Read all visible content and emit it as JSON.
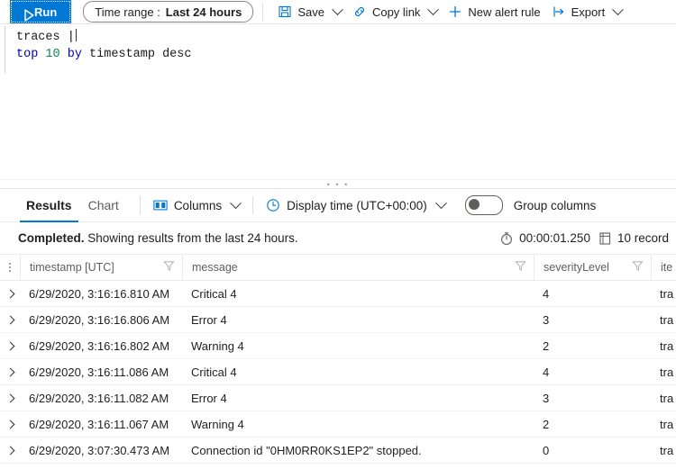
{
  "toolbar": {
    "run_label": "Run",
    "run_icon": "play-icon",
    "time_range_label": "Time range :",
    "time_range_value": "Last 24 hours",
    "save_label": "Save",
    "save_icon": "save-disk-icon",
    "copy_link_label": "Copy link",
    "copy_link_icon": "link-icon",
    "new_alert_label": "New alert rule",
    "new_alert_icon": "plus-icon",
    "export_label": "Export",
    "export_icon": "export-arrow-icon",
    "chevron_icon": "chevron-down-icon"
  },
  "editor": {
    "line1": {
      "table": "traces",
      "pipe": "|"
    },
    "line2": {
      "kw_top": "top",
      "number": "10",
      "kw_by": "by",
      "field": "timestamp",
      "kw_desc": "desc"
    }
  },
  "splitter": {
    "handle": "• • •"
  },
  "results_bar": {
    "tabs": [
      {
        "label": "Results",
        "active": true
      },
      {
        "label": "Chart",
        "active": false
      }
    ],
    "columns_label": "Columns",
    "columns_icon": "columns-icon",
    "display_time_label": "Display time (UTC+00:00)",
    "display_time_icon": "clock-icon",
    "group_columns_label": "Group columns",
    "group_columns_on": false
  },
  "status": {
    "state": "Completed.",
    "message": " Showing results from the last 24 hours.",
    "duration_icon": "timer-icon",
    "duration": "00:00:01.250",
    "records_icon": "records-icon",
    "records": "10 record"
  },
  "grid": {
    "row_menu_icon": "column-options-icon",
    "filter_icon": "filter-funnel-icon",
    "expand_icon": "chevron-right-icon",
    "columns": [
      {
        "label": "timestamp [UTC]",
        "filter": true
      },
      {
        "label": "message",
        "filter": true
      },
      {
        "label": "severityLevel",
        "filter": true
      },
      {
        "label": "ite",
        "filter": false
      }
    ],
    "rows": [
      {
        "timestamp": "6/29/2020, 3:16:16.810 AM",
        "message": "Critical 4",
        "severityLevel": "4",
        "itemType": "tra"
      },
      {
        "timestamp": "6/29/2020, 3:16:16.806 AM",
        "message": "Error 4",
        "severityLevel": "3",
        "itemType": "tra"
      },
      {
        "timestamp": "6/29/2020, 3:16:16.802 AM",
        "message": "Warning 4",
        "severityLevel": "2",
        "itemType": "tra"
      },
      {
        "timestamp": "6/29/2020, 3:16:11.086 AM",
        "message": "Critical 4",
        "severityLevel": "4",
        "itemType": "tra"
      },
      {
        "timestamp": "6/29/2020, 3:16:11.082 AM",
        "message": "Error 4",
        "severityLevel": "3",
        "itemType": "tra"
      },
      {
        "timestamp": "6/29/2020, 3:16:11.067 AM",
        "message": "Warning 4",
        "severityLevel": "2",
        "itemType": "tra"
      },
      {
        "timestamp": "6/29/2020, 3:07:30.473 AM",
        "message": "Connection id \"0HM0RR0KS1EP2\" stopped.",
        "severityLevel": "0",
        "itemType": "tra"
      }
    ]
  },
  "colors": {
    "accent": "#0078d4",
    "keyword": "#0000c0",
    "number": "#098658",
    "text": "#201f1e",
    "muted": "#605e5c",
    "border": "#edebe9"
  }
}
